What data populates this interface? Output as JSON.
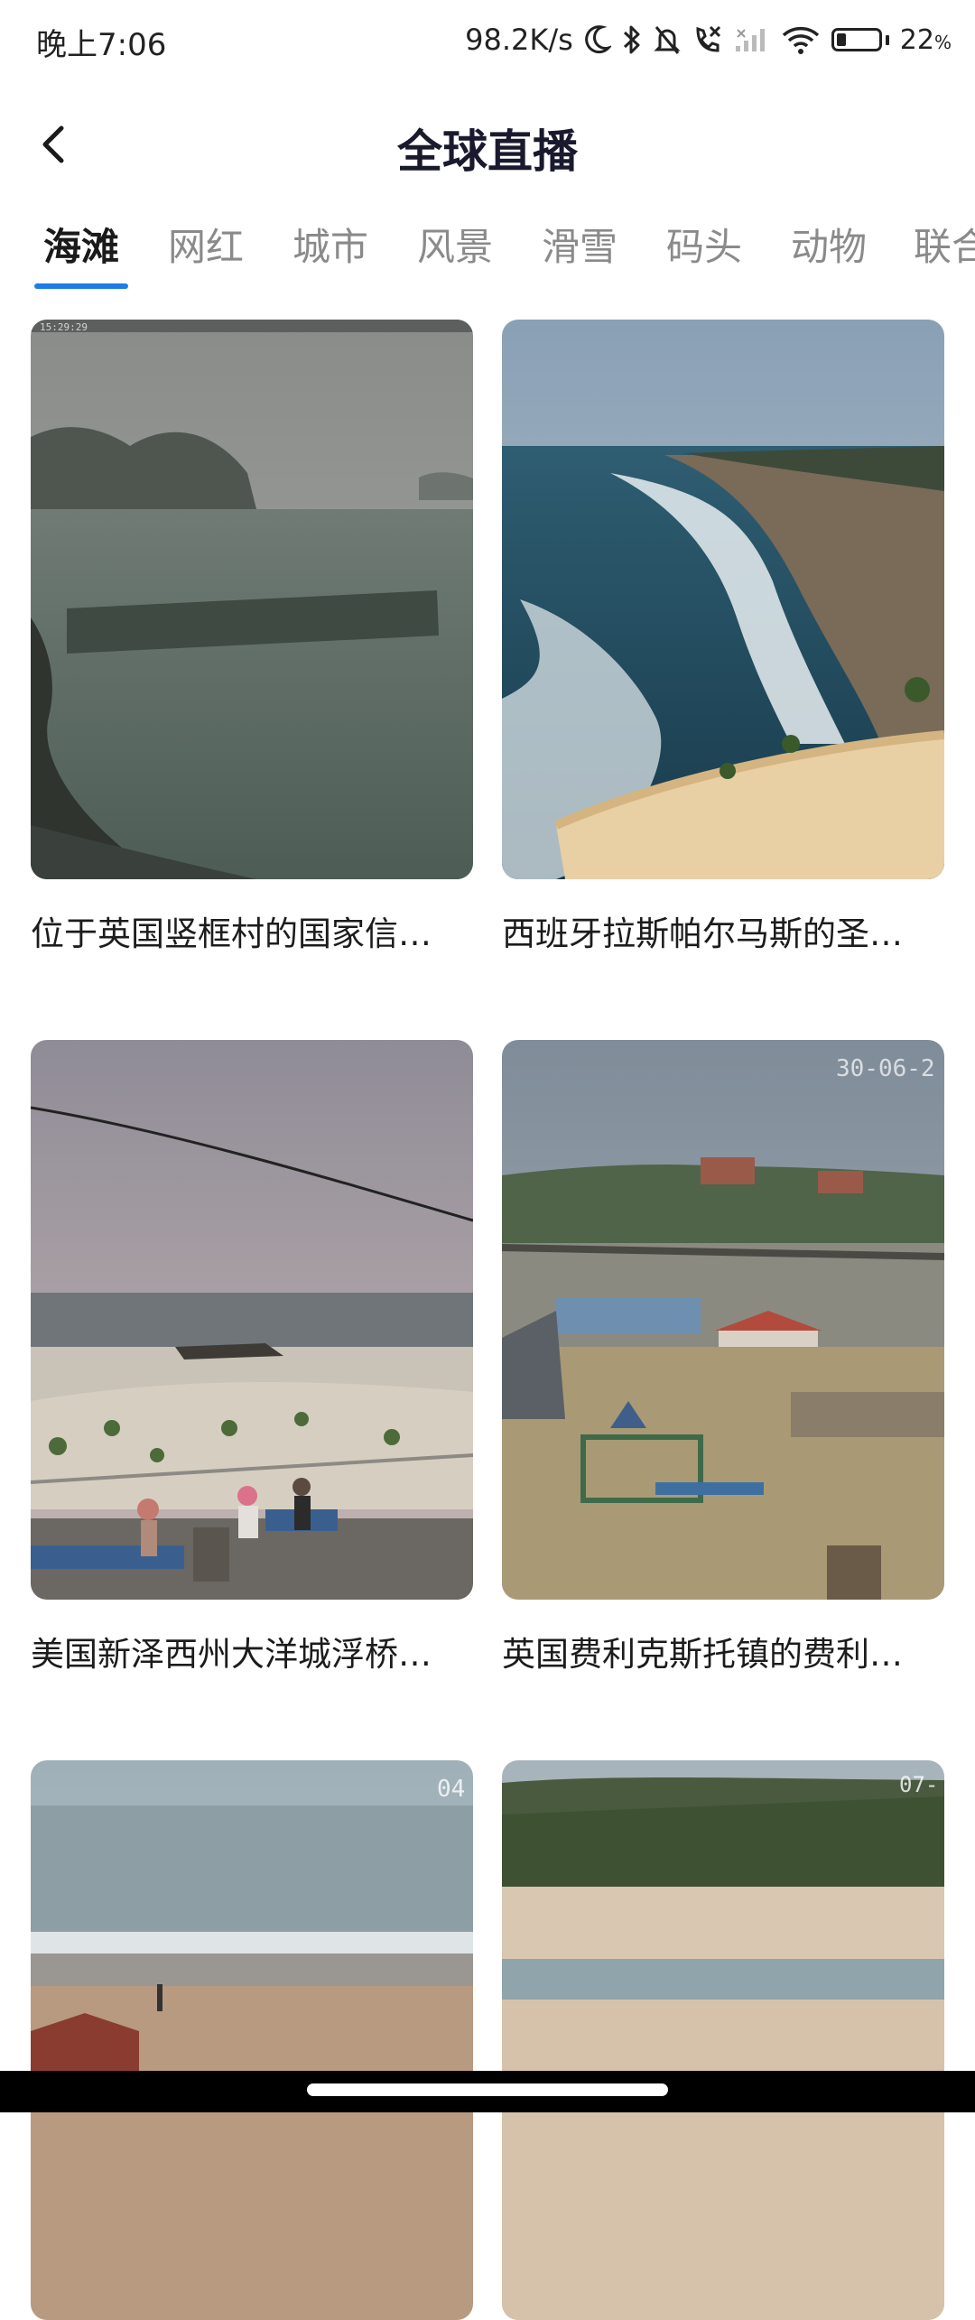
{
  "status_bar": {
    "time": "晚上7:06",
    "network_speed": "98.2K/s",
    "battery_percent": "22",
    "battery_unit": "%",
    "battery_level": 0.22,
    "icons": [
      "moon-icon",
      "bluetooth-icon",
      "bell-muted-icon",
      "call-forward-icon",
      "cellular-signal-icon",
      "wifi-icon",
      "battery-icon"
    ]
  },
  "header": {
    "back_icon": "back-arrow-icon",
    "title": "全球直播"
  },
  "tabs": [
    {
      "label": "海滩",
      "active": true
    },
    {
      "label": "网红",
      "active": false
    },
    {
      "label": "城市",
      "active": false
    },
    {
      "label": "风景",
      "active": false
    },
    {
      "label": "滑雪",
      "active": false
    },
    {
      "label": "码头",
      "active": false
    },
    {
      "label": "动物",
      "active": false
    },
    {
      "label": "联合",
      "active": false
    }
  ],
  "accent_color": "#1e7ce8",
  "cards": [
    {
      "title": "位于英国竖框村的国家信…",
      "timestamp": "15:29:29"
    },
    {
      "title": "西班牙拉斯帕尔马斯的圣…",
      "timestamp": ""
    },
    {
      "title": "美国新泽西州大洋城浮桥…",
      "timestamp": ""
    },
    {
      "title": "英国费利克斯托镇的费利…",
      "timestamp": "30-06-2"
    },
    {
      "title": "",
      "timestamp": "04"
    },
    {
      "title": "",
      "timestamp": "07-"
    }
  ]
}
